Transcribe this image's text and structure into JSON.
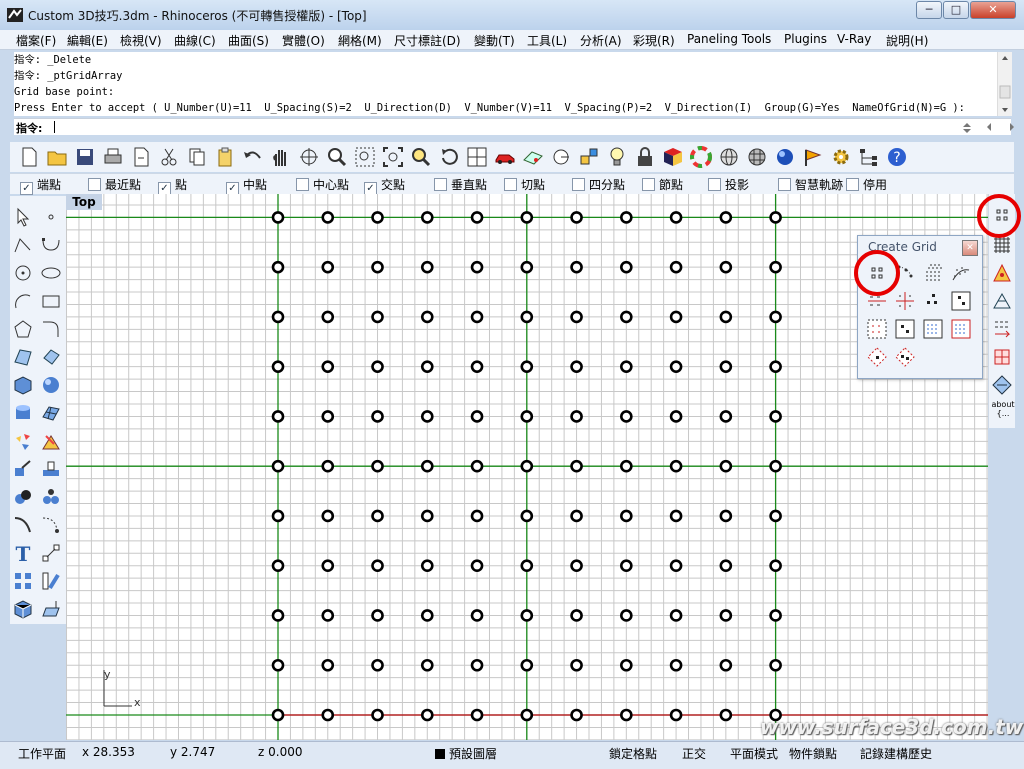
{
  "window": {
    "title": "Custom 3D技巧.3dm - Rhinoceros (不可轉售授權版) - [Top]",
    "minimize": "─",
    "maximize": "□",
    "close": "✕"
  },
  "menu": [
    "檔案(F)",
    "編輯(E)",
    "檢視(V)",
    "曲線(C)",
    "曲面(S)",
    "實體(O)",
    "網格(M)",
    "尺寸標註(D)",
    "變動(T)",
    "工具(L)",
    "分析(A)",
    "彩現(R)",
    "Paneling Tools",
    "Plugins",
    "V-Ray",
    "說明(H)"
  ],
  "command_history": [
    "指令: _Delete",
    "指令: _ptGridArray",
    "Grid base point:",
    "Press Enter to accept ( U_Number(U)=11  U_Spacing(S)=2  U_Direction(D)  V_Number(V)=11  V_Spacing(P)=2  V_Direction(I)  Group(G)=Yes  NameOfGrid(N)=G ):"
  ],
  "command_prompt": "指令:",
  "osnaps": [
    {
      "label": "端點",
      "checked": true
    },
    {
      "label": "最近點",
      "checked": false
    },
    {
      "label": "點",
      "checked": true
    },
    {
      "label": "中點",
      "checked": true
    },
    {
      "label": "中心點",
      "checked": false
    },
    {
      "label": "交點",
      "checked": true
    },
    {
      "label": "垂直點",
      "checked": false
    },
    {
      "label": "切點",
      "checked": false
    },
    {
      "label": "四分點",
      "checked": false
    },
    {
      "label": "節點",
      "checked": false
    },
    {
      "label": "投影",
      "checked": false
    },
    {
      "label": "智慧軌跡",
      "checked": false
    },
    {
      "label": "停用",
      "checked": false
    }
  ],
  "viewport": {
    "name": "Top",
    "axis_x": "x",
    "axis_y": "y",
    "grid": {
      "u_count": 11,
      "v_count": 11
    }
  },
  "create_grid_panel": {
    "title": "Create Grid",
    "close": "✕"
  },
  "right_toolbar": {
    "about_label": "about",
    "about_sub": "{..."
  },
  "watermark": "www.surface3d.com.tw",
  "status": {
    "cplane": "工作平面",
    "x": "x 28.353",
    "y": "y 2.747",
    "z": "z 0.000",
    "layer": "預設圖層",
    "toggles": [
      "鎖定格點",
      "正交",
      "平面模式",
      "物件鎖點",
      "記錄建構歷史"
    ]
  },
  "colors": {
    "accent_red": "#e60000",
    "grid_green": "#1a8a1a",
    "grid_gray": "#c8c8c8"
  },
  "icons": [
    "new-file-icon",
    "open-file-icon",
    "save-icon",
    "print-icon",
    "import-icon",
    "cut-icon",
    "copy-icon",
    "paste-icon",
    "undo-icon",
    "pan-hand-icon",
    "rotate-view-icon",
    "zoom-icon",
    "zoom-window-icon",
    "zoom-extents-icon",
    "zoom-selected-icon",
    "undo-view-icon",
    "four-viewports-icon",
    "car-icon",
    "grid-plane-icon",
    "circle-target-icon",
    "osnap-icon",
    "light-bulb-icon",
    "lock-icon",
    "material-icon",
    "color-wheel-icon",
    "sphere-wire-icon",
    "sphere-mesh-icon",
    "render-sphere-icon",
    "render-flag-icon",
    "gear-icon",
    "tree-icon",
    "help-icon"
  ]
}
